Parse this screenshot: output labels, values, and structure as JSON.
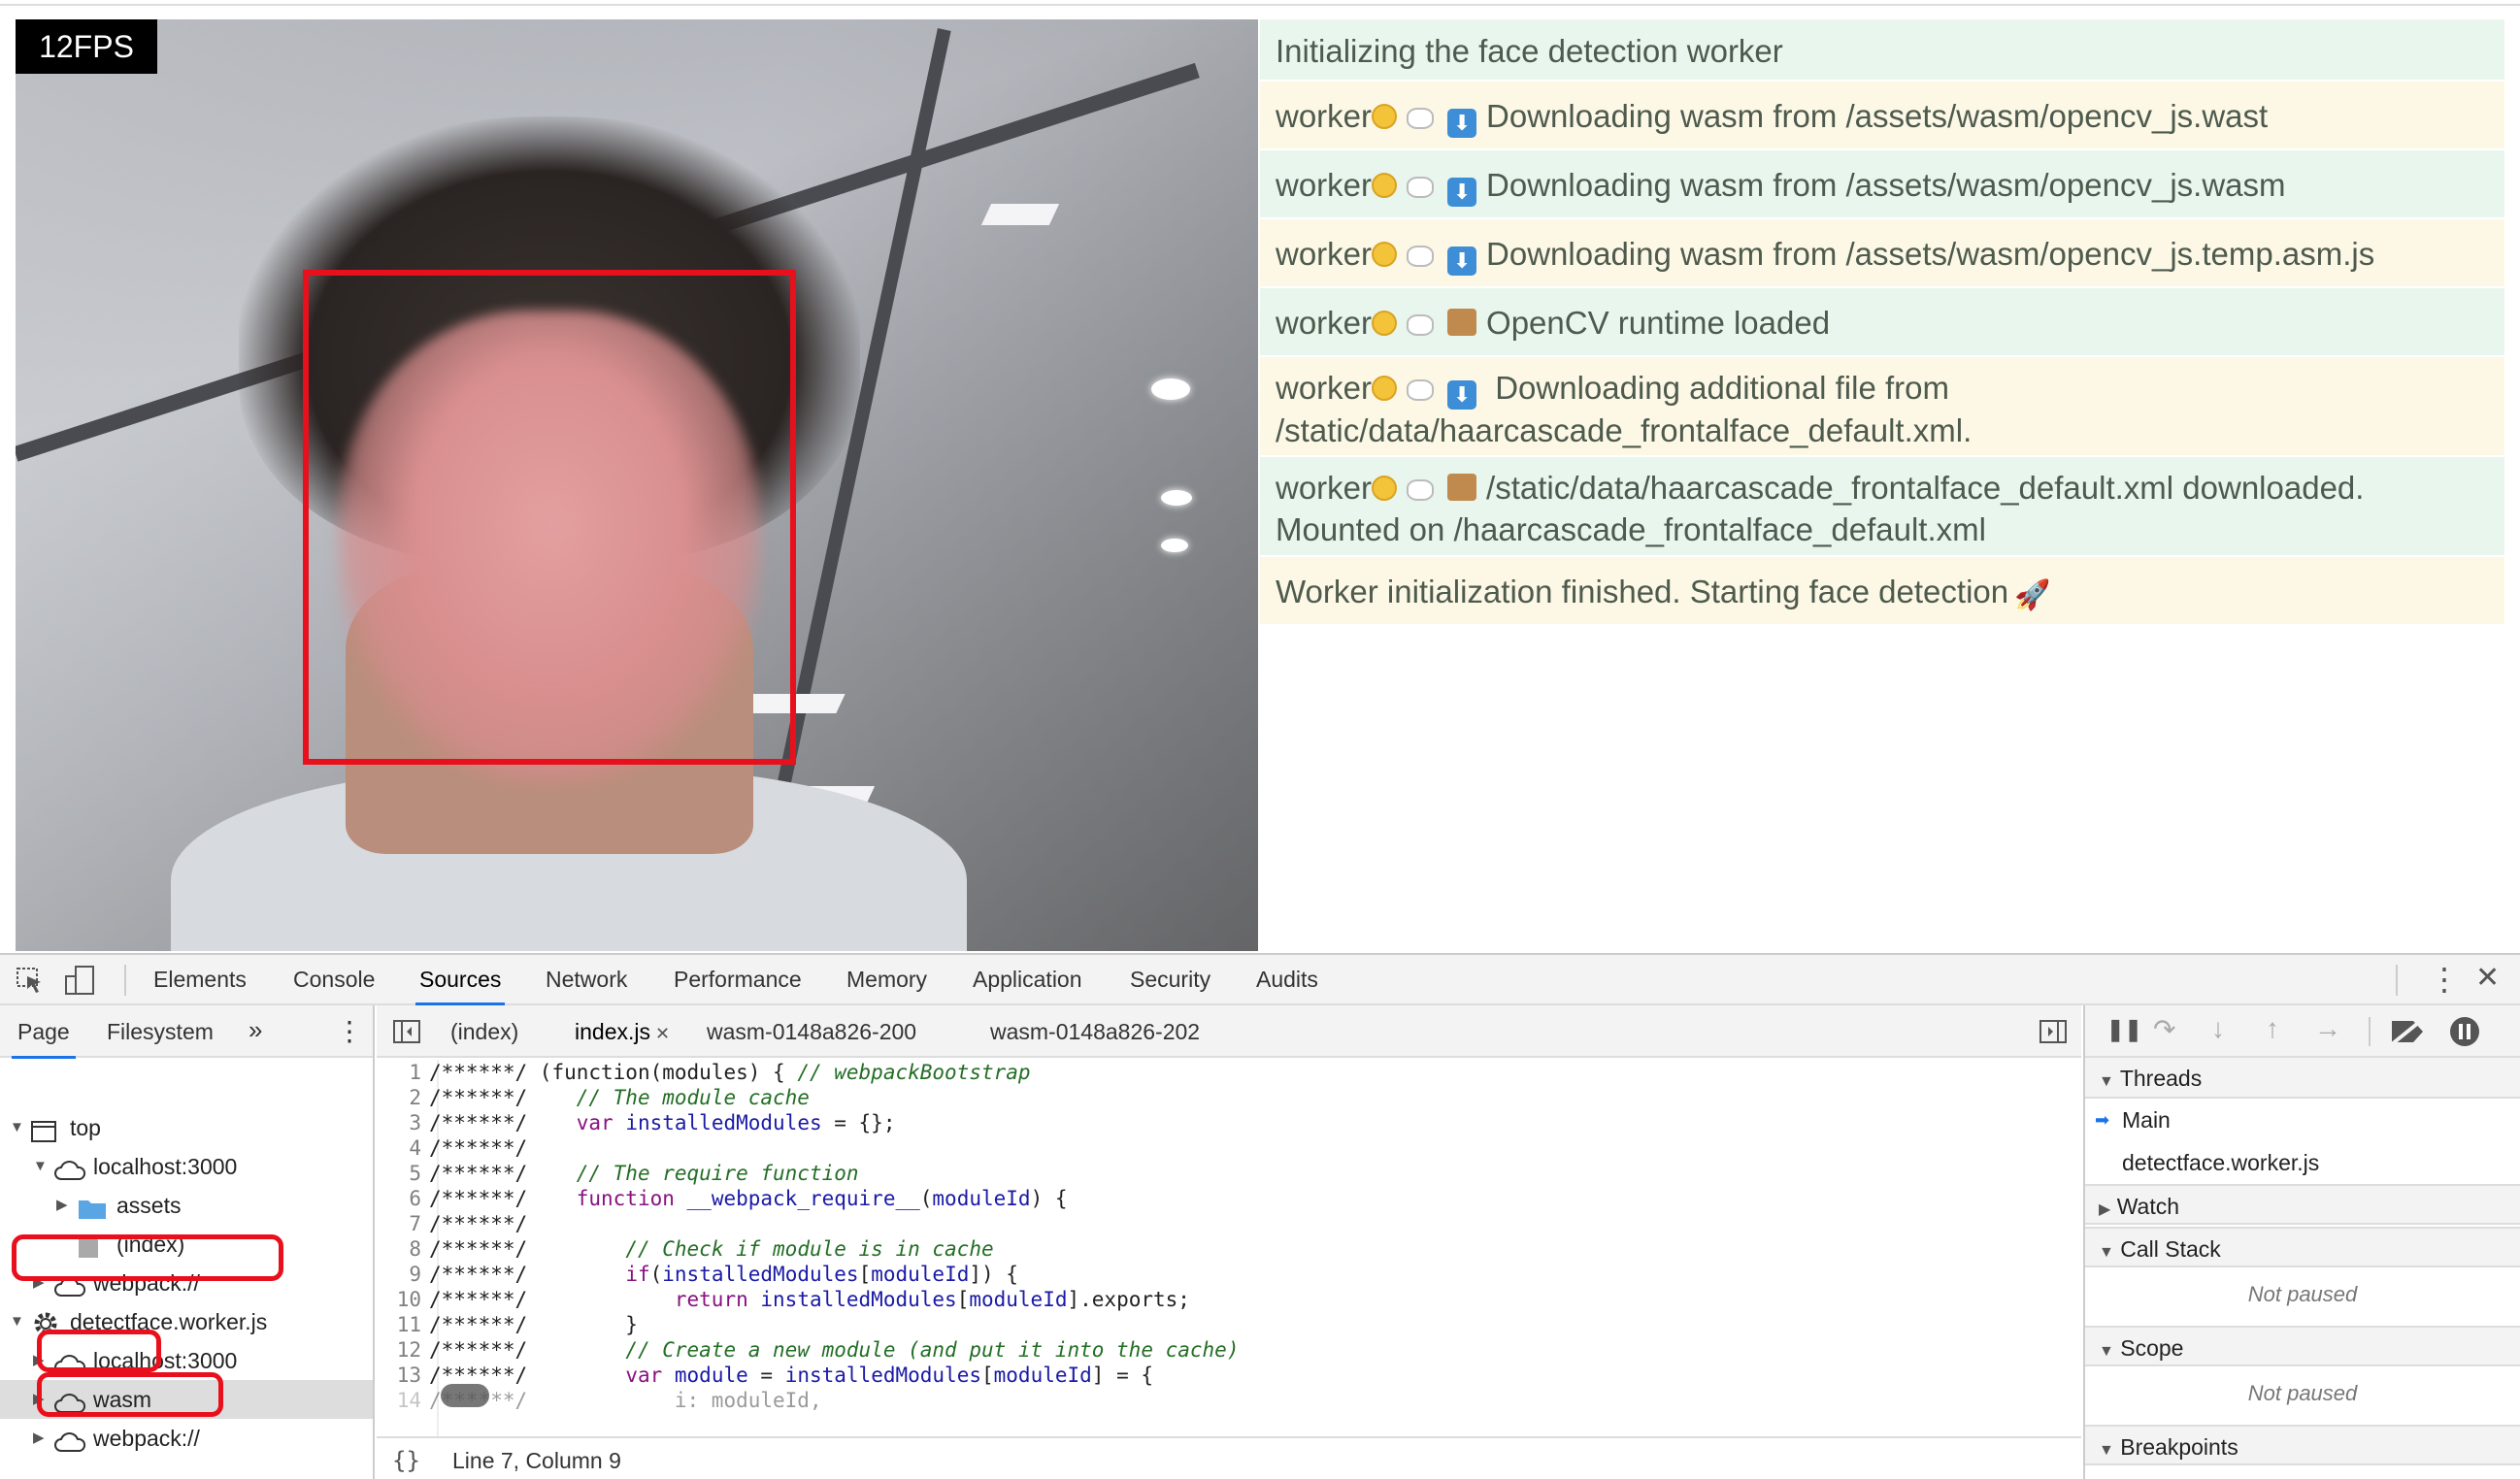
{
  "app": {
    "fps_label": "12FPS",
    "log": [
      {
        "text": "Initializing the face detection worker",
        "style": "green",
        "prefix": false,
        "icon": ""
      },
      {
        "text": "Downloading wasm from /assets/wasm/opencv_js.wast",
        "style": "yellow",
        "prefix": true,
        "icon": "download-icon"
      },
      {
        "text": "Downloading wasm from /assets/wasm/opencv_js.wasm",
        "style": "green",
        "prefix": true,
        "icon": "download-icon"
      },
      {
        "text": "Downloading wasm from /assets/wasm/opencv_js.temp.asm.js",
        "style": "yellow",
        "prefix": true,
        "icon": "download-icon"
      },
      {
        "text": "OpenCV runtime loaded",
        "style": "green",
        "prefix": true,
        "icon": "package-icon"
      },
      {
        "text": " Downloading additional file from /static/data/haarcascade_frontalface_default.xml.",
        "style": "yellow",
        "prefix": true,
        "icon": "download-icon"
      },
      {
        "text": "/static/data/haarcascade_frontalface_default.xml downloaded. Mounted on /haarcascade_frontalface_default.xml",
        "style": "green",
        "prefix": true,
        "icon": "package-icon"
      },
      {
        "text": "Worker initialization finished. Starting face detection",
        "style": "yellow",
        "prefix": false,
        "icon": "rocket-icon"
      }
    ],
    "worker_prefix": "worker"
  },
  "devtools": {
    "tabs": [
      "Elements",
      "Console",
      "Sources",
      "Network",
      "Performance",
      "Memory",
      "Application",
      "Security",
      "Audits"
    ],
    "active_tab": "Sources",
    "navigator": {
      "tabs": [
        "Page",
        "Filesystem"
      ],
      "more": "»",
      "tree": [
        {
          "label": "top",
          "depth": 0,
          "expanded": true,
          "icon": "frame-icon"
        },
        {
          "label": "localhost:3000",
          "depth": 1,
          "expanded": true,
          "icon": "cloud-icon"
        },
        {
          "label": "assets",
          "depth": 2,
          "expanded": false,
          "icon": "folder-icon"
        },
        {
          "label": "(index)",
          "depth": 2,
          "expanded": null,
          "icon": "file-icon"
        },
        {
          "label": "webpack://",
          "depth": 1,
          "expanded": false,
          "icon": "cloud-icon"
        },
        {
          "label": "detectface.worker.js",
          "depth": 0,
          "expanded": true,
          "icon": "gear-icon"
        },
        {
          "label": "localhost:3000",
          "depth": 1,
          "expanded": false,
          "icon": "cloud-icon"
        },
        {
          "label": "wasm",
          "depth": 1,
          "expanded": false,
          "icon": "cloud-icon",
          "selected": true
        },
        {
          "label": "webpack://",
          "depth": 1,
          "expanded": false,
          "icon": "cloud-icon"
        }
      ]
    },
    "editor": {
      "tabs": [
        "(index)",
        "index.js",
        "wasm-0148a826-200",
        "wasm-0148a826-202"
      ],
      "active_tab": "index.js",
      "lines": [
        {
          "n": "1",
          "prefix": "/******/ ",
          "parts": [
            [
              "pl",
              "(function(modules) { "
            ],
            [
              "cm",
              "// webpackBootstrap"
            ]
          ]
        },
        {
          "n": "2",
          "prefix": "/******/ ",
          "parts": [
            [
              "pl",
              "   "
            ],
            [
              "cm",
              "// The module cache"
            ]
          ]
        },
        {
          "n": "3",
          "prefix": "/******/ ",
          "parts": [
            [
              "pl",
              "   "
            ],
            [
              "kw",
              "var "
            ],
            [
              "cd",
              "installedModules"
            ],
            [
              "pl",
              " = {};"
            ]
          ]
        },
        {
          "n": "4",
          "prefix": "/******/",
          "parts": []
        },
        {
          "n": "5",
          "prefix": "/******/ ",
          "parts": [
            [
              "pl",
              "   "
            ],
            [
              "cm",
              "// The require function"
            ]
          ]
        },
        {
          "n": "6",
          "prefix": "/******/ ",
          "parts": [
            [
              "pl",
              "   "
            ],
            [
              "kw",
              "function "
            ],
            [
              "cd",
              "__webpack_require__"
            ],
            [
              "pl",
              "("
            ],
            [
              "cd",
              "moduleId"
            ],
            [
              "pl",
              ") {"
            ]
          ]
        },
        {
          "n": "7",
          "prefix": "/******/",
          "parts": []
        },
        {
          "n": "8",
          "prefix": "/******/ ",
          "parts": [
            [
              "pl",
              "       "
            ],
            [
              "cm",
              "// Check if module is in cache"
            ]
          ]
        },
        {
          "n": "9",
          "prefix": "/******/ ",
          "parts": [
            [
              "pl",
              "       "
            ],
            [
              "kw",
              "if"
            ],
            [
              "pl",
              "("
            ],
            [
              "cd",
              "installedModules"
            ],
            [
              "pl",
              "["
            ],
            [
              "cd",
              "moduleId"
            ],
            [
              "pl",
              "]) {"
            ]
          ]
        },
        {
          "n": "10",
          "prefix": "/******/ ",
          "parts": [
            [
              "pl",
              "           "
            ],
            [
              "kw",
              "return "
            ],
            [
              "cd",
              "installedModules"
            ],
            [
              "pl",
              "["
            ],
            [
              "cd",
              "moduleId"
            ],
            [
              "pl",
              "].exports;"
            ]
          ]
        },
        {
          "n": "11",
          "prefix": "/******/ ",
          "parts": [
            [
              "pl",
              "       }"
            ]
          ]
        },
        {
          "n": "12",
          "prefix": "/******/ ",
          "parts": [
            [
              "pl",
              "       "
            ],
            [
              "cm",
              "// Create a new module (and put it into the cache)"
            ]
          ]
        },
        {
          "n": "13",
          "prefix": "/******/ ",
          "parts": [
            [
              "pl",
              "       "
            ],
            [
              "kw",
              "var "
            ],
            [
              "cd",
              "module"
            ],
            [
              "pl",
              " = "
            ],
            [
              "cd",
              "installedModules"
            ],
            [
              "pl",
              "["
            ],
            [
              "cd",
              "moduleId"
            ],
            [
              "pl",
              "] = {"
            ]
          ]
        },
        {
          "n": "14",
          "prefix": "/******/ ",
          "parts": [
            [
              "pl",
              "           i: moduleId,"
            ]
          ]
        }
      ],
      "status": "Line 7, Column 9",
      "format_icon": "{}"
    },
    "debugger": {
      "threads_label": "Threads",
      "threads": [
        "Main",
        "detectface.worker.js"
      ],
      "watch_label": "Watch",
      "callstack_label": "Call Stack",
      "not_paused": "Not paused",
      "scope_label": "Scope",
      "breakpoints_label": "Breakpoints"
    }
  }
}
